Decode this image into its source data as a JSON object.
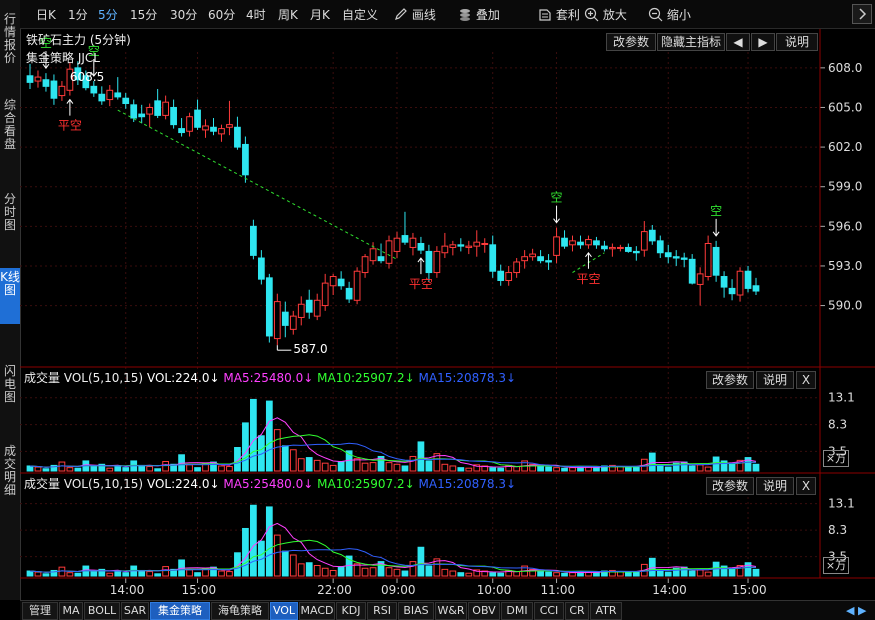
{
  "sidebar": [
    {
      "label": "行情报价",
      "active": false
    },
    {
      "label": "综合看盘",
      "active": false
    },
    {
      "label": "分时图",
      "active": false
    },
    {
      "label": "K线图",
      "active": true
    },
    {
      "label": "闪电图",
      "active": false
    },
    {
      "label": "成交明细",
      "active": false
    }
  ],
  "toolbar": {
    "periods": [
      "日K",
      "1分",
      "5分",
      "15分",
      "30分",
      "60分",
      "4时",
      "周K",
      "月K",
      "自定义"
    ],
    "active_period": "5分",
    "tools": [
      {
        "label": "画线",
        "icon": "pencil-icon"
      },
      {
        "label": "叠加",
        "icon": "stack-icon"
      },
      {
        "label": "套利",
        "icon": "arbitrage-icon"
      },
      {
        "label": "放大",
        "icon": "zoom-in-icon"
      },
      {
        "label": "缩小",
        "icon": "zoom-out-icon"
      }
    ],
    "collapse_icon": "chevron-right-icon"
  },
  "main_panel": {
    "title": "铁矿石主力 (5分钟)",
    "buttons": [
      "改参数",
      "隐藏主指标",
      "◀",
      "▶",
      "说明"
    ],
    "strategy_label": "集金策略 JJCL"
  },
  "chart_data": [
    {
      "type": "candlestick",
      "title": "铁矿石主力 (5分钟)",
      "yticks": [
        608.0,
        605.0,
        602.0,
        599.0,
        596.0,
        593.0,
        590.0
      ],
      "ylim": [
        585.5,
        609.2
      ],
      "xticks": [
        "14:00",
        "15:00",
        "22:00",
        "09:00",
        "10:00",
        "11:00",
        "14:00",
        "15:00"
      ],
      "up_color": "#ff3b3b",
      "down_color": "#2ee6f0",
      "high_label": "608.5",
      "low_label": "587.0",
      "candles": [
        {
          "o": 607.4,
          "h": 608.3,
          "l": 606.4,
          "c": 606.9
        },
        {
          "o": 607.0,
          "h": 607.8,
          "l": 606.5,
          "c": 607.3
        },
        {
          "o": 607.1,
          "h": 607.6,
          "l": 606.2,
          "c": 606.6
        },
        {
          "o": 607.0,
          "h": 607.5,
          "l": 605.2,
          "c": 605.7
        },
        {
          "o": 605.9,
          "h": 607.0,
          "l": 605.5,
          "c": 606.6
        },
        {
          "o": 606.3,
          "h": 608.4,
          "l": 605.9,
          "c": 607.9
        },
        {
          "o": 608.0,
          "h": 608.5,
          "l": 606.7,
          "c": 607.1
        },
        {
          "o": 607.4,
          "h": 607.8,
          "l": 606.3,
          "c": 606.5
        },
        {
          "o": 606.6,
          "h": 607.0,
          "l": 605.8,
          "c": 606.1
        },
        {
          "o": 606.0,
          "h": 606.6,
          "l": 605.2,
          "c": 605.5
        },
        {
          "o": 605.6,
          "h": 606.7,
          "l": 605.1,
          "c": 606.3
        },
        {
          "o": 606.1,
          "h": 607.3,
          "l": 605.6,
          "c": 605.8
        },
        {
          "o": 605.7,
          "h": 606.1,
          "l": 604.9,
          "c": 605.3
        },
        {
          "o": 605.2,
          "h": 605.6,
          "l": 603.9,
          "c": 604.2
        },
        {
          "o": 604.5,
          "h": 605.2,
          "l": 603.8,
          "c": 604.3
        },
        {
          "o": 604.5,
          "h": 605.3,
          "l": 603.5,
          "c": 605.0
        },
        {
          "o": 605.5,
          "h": 606.4,
          "l": 604.2,
          "c": 604.4
        },
        {
          "o": 604.4,
          "h": 605.9,
          "l": 604.1,
          "c": 605.4
        },
        {
          "o": 605.0,
          "h": 605.6,
          "l": 603.4,
          "c": 603.7
        },
        {
          "o": 603.4,
          "h": 604.2,
          "l": 602.8,
          "c": 603.1
        },
        {
          "o": 603.2,
          "h": 604.6,
          "l": 602.8,
          "c": 604.3
        },
        {
          "o": 604.8,
          "h": 605.6,
          "l": 603.3,
          "c": 603.5
        },
        {
          "o": 603.3,
          "h": 604.1,
          "l": 602.7,
          "c": 603.6
        },
        {
          "o": 603.5,
          "h": 604.2,
          "l": 602.9,
          "c": 603.2
        },
        {
          "o": 603.0,
          "h": 603.7,
          "l": 602.4,
          "c": 603.4
        },
        {
          "o": 603.5,
          "h": 605.5,
          "l": 602.9,
          "c": 603.7
        },
        {
          "o": 603.5,
          "h": 604.3,
          "l": 601.8,
          "c": 602.0
        },
        {
          "o": 602.2,
          "h": 602.8,
          "l": 599.3,
          "c": 599.9
        },
        {
          "o": 596.0,
          "h": 596.5,
          "l": 593.5,
          "c": 593.8
        },
        {
          "o": 593.6,
          "h": 594.2,
          "l": 591.6,
          "c": 592.0
        },
        {
          "o": 592.1,
          "h": 592.4,
          "l": 587.2,
          "c": 587.7
        },
        {
          "o": 587.5,
          "h": 590.9,
          "l": 587.0,
          "c": 590.3
        },
        {
          "o": 589.5,
          "h": 590.3,
          "l": 587.6,
          "c": 588.5
        },
        {
          "o": 588.2,
          "h": 589.6,
          "l": 587.8,
          "c": 589.2
        },
        {
          "o": 589.1,
          "h": 590.7,
          "l": 588.5,
          "c": 590.1
        },
        {
          "o": 590.4,
          "h": 591.2,
          "l": 589.0,
          "c": 589.5
        },
        {
          "o": 589.2,
          "h": 590.9,
          "l": 588.9,
          "c": 590.4
        },
        {
          "o": 590.0,
          "h": 592.4,
          "l": 589.6,
          "c": 591.7
        },
        {
          "o": 591.5,
          "h": 592.4,
          "l": 590.8,
          "c": 592.2
        },
        {
          "o": 592.0,
          "h": 592.6,
          "l": 591.2,
          "c": 591.5
        },
        {
          "o": 591.3,
          "h": 591.8,
          "l": 590.2,
          "c": 590.5
        },
        {
          "o": 590.4,
          "h": 592.9,
          "l": 590.1,
          "c": 592.6
        },
        {
          "o": 592.5,
          "h": 593.9,
          "l": 592.1,
          "c": 593.7
        },
        {
          "o": 593.4,
          "h": 594.8,
          "l": 593.1,
          "c": 594.3
        },
        {
          "o": 593.7,
          "h": 594.7,
          "l": 593.2,
          "c": 593.4
        },
        {
          "o": 593.2,
          "h": 595.3,
          "l": 592.8,
          "c": 594.9
        },
        {
          "o": 594.1,
          "h": 595.6,
          "l": 593.6,
          "c": 595.1
        },
        {
          "o": 595.3,
          "h": 597.1,
          "l": 594.6,
          "c": 594.8
        },
        {
          "o": 594.4,
          "h": 595.5,
          "l": 593.8,
          "c": 595.1
        },
        {
          "o": 594.7,
          "h": 595.2,
          "l": 593.9,
          "c": 594.2
        },
        {
          "o": 594.1,
          "h": 594.6,
          "l": 591.8,
          "c": 592.5
        },
        {
          "o": 592.5,
          "h": 594.5,
          "l": 592.1,
          "c": 594.1
        },
        {
          "o": 594.0,
          "h": 595.5,
          "l": 593.6,
          "c": 594.5
        },
        {
          "o": 594.4,
          "h": 594.9,
          "l": 593.8,
          "c": 594.6
        },
        {
          "o": 594.6,
          "h": 595.1,
          "l": 594.1,
          "c": 594.5
        },
        {
          "o": 594.4,
          "h": 594.9,
          "l": 593.9,
          "c": 594.5
        },
        {
          "o": 594.5,
          "h": 595.7,
          "l": 593.7,
          "c": 594.8
        },
        {
          "o": 594.7,
          "h": 595.1,
          "l": 594.0,
          "c": 594.7
        },
        {
          "o": 594.6,
          "h": 595.3,
          "l": 592.1,
          "c": 592.6
        },
        {
          "o": 592.6,
          "h": 593.1,
          "l": 591.5,
          "c": 591.9
        },
        {
          "o": 591.9,
          "h": 593.0,
          "l": 591.5,
          "c": 592.5
        },
        {
          "o": 592.5,
          "h": 593.6,
          "l": 592.1,
          "c": 593.3
        },
        {
          "o": 593.4,
          "h": 594.2,
          "l": 592.8,
          "c": 593.7
        },
        {
          "o": 593.7,
          "h": 594.3,
          "l": 593.4,
          "c": 593.9
        },
        {
          "o": 593.7,
          "h": 594.2,
          "l": 593.2,
          "c": 593.4
        },
        {
          "o": 593.4,
          "h": 593.9,
          "l": 592.7,
          "c": 593.3
        },
        {
          "o": 593.8,
          "h": 595.9,
          "l": 593.2,
          "c": 595.2
        },
        {
          "o": 595.1,
          "h": 595.7,
          "l": 594.3,
          "c": 594.5
        },
        {
          "o": 594.6,
          "h": 595.3,
          "l": 594.1,
          "c": 594.9
        },
        {
          "o": 594.8,
          "h": 595.3,
          "l": 594.3,
          "c": 594.6
        },
        {
          "o": 594.6,
          "h": 595.3,
          "l": 594.3,
          "c": 595.0
        },
        {
          "o": 594.9,
          "h": 595.2,
          "l": 594.3,
          "c": 594.6
        },
        {
          "o": 594.5,
          "h": 594.9,
          "l": 594.1,
          "c": 594.3
        },
        {
          "o": 594.3,
          "h": 594.7,
          "l": 593.7,
          "c": 594.4
        },
        {
          "o": 594.4,
          "h": 594.6,
          "l": 594.1,
          "c": 594.4
        },
        {
          "o": 594.4,
          "h": 594.7,
          "l": 594.0,
          "c": 594.1
        },
        {
          "o": 594.1,
          "h": 594.5,
          "l": 593.4,
          "c": 594.0
        },
        {
          "o": 594.2,
          "h": 596.4,
          "l": 593.7,
          "c": 595.6
        },
        {
          "o": 595.7,
          "h": 596.1,
          "l": 594.6,
          "c": 594.9
        },
        {
          "o": 594.9,
          "h": 595.3,
          "l": 593.6,
          "c": 594.0
        },
        {
          "o": 594.0,
          "h": 594.6,
          "l": 593.2,
          "c": 593.7
        },
        {
          "o": 593.7,
          "h": 594.2,
          "l": 593.0,
          "c": 593.6
        },
        {
          "o": 593.6,
          "h": 594.0,
          "l": 592.9,
          "c": 593.5
        },
        {
          "o": 593.5,
          "h": 593.9,
          "l": 591.6,
          "c": 591.7
        },
        {
          "o": 591.6,
          "h": 592.9,
          "l": 590.0,
          "c": 592.4
        },
        {
          "o": 592.2,
          "h": 595.3,
          "l": 591.9,
          "c": 594.7
        },
        {
          "o": 594.4,
          "h": 594.9,
          "l": 591.8,
          "c": 592.3
        },
        {
          "o": 592.2,
          "h": 592.6,
          "l": 590.6,
          "c": 591.4
        },
        {
          "o": 591.3,
          "h": 592.0,
          "l": 590.4,
          "c": 590.9
        },
        {
          "o": 590.8,
          "h": 592.9,
          "l": 590.3,
          "c": 592.6
        },
        {
          "o": 592.6,
          "h": 593.0,
          "l": 591.0,
          "c": 591.3
        },
        {
          "o": 591.5,
          "h": 592.1,
          "l": 590.8,
          "c": 591.1
        }
      ],
      "signals": [
        {
          "i": 2,
          "type": "kong",
          "label": "空"
        },
        {
          "i": 5,
          "type": "pingkong",
          "label": "平空"
        },
        {
          "i": 8,
          "type": "kong",
          "label": "空"
        },
        {
          "i": 49,
          "type": "pingkong",
          "label": "平空"
        },
        {
          "i": 66,
          "type": "kong",
          "label": "空"
        },
        {
          "i": 70,
          "type": "pingkong",
          "label": "平空"
        },
        {
          "i": 86,
          "type": "kong",
          "label": "空"
        }
      ],
      "trend_line": [
        {
          "i": 11,
          "v": 604.8
        },
        {
          "i": 46,
          "v": 593.5
        }
      ],
      "trend_line2": [
        {
          "i": 68,
          "v": 592.5
        },
        {
          "i": 72,
          "v": 594.0
        }
      ]
    },
    {
      "type": "bar",
      "title": "成交量 VOL(5,10,15)",
      "yticks": [
        13.1,
        8.3,
        3.5
      ],
      "ylim": [
        0,
        15.2
      ],
      "unit": "×万",
      "values": [
        0.9,
        0.7,
        0.4,
        1.0,
        1.6,
        0.6,
        0.5,
        1.8,
        0.8,
        1.2,
        0.5,
        0.9,
        0.6,
        1.8,
        1.0,
        0.8,
        0.4,
        1.7,
        1.2,
        2.9,
        1.1,
        0.6,
        1.4,
        1.6,
        0.9,
        0.8,
        4.2,
        8.6,
        12.8,
        6.3,
        12.5,
        7.4,
        4.5,
        3.8,
        2.2,
        2.4,
        1.9,
        1.4,
        1.0,
        1.7,
        3.6,
        2.2,
        1.4,
        1.5,
        2.6,
        1.5,
        1.2,
        0.9,
        2.6,
        5.2,
        1.8,
        3.1,
        1.2,
        0.9,
        0.6,
        0.5,
        1.1,
        0.9,
        0.6,
        0.5,
        1.0,
        0.8,
        1.8,
        1.2,
        0.8,
        0.7,
        0.6,
        0.5,
        0.6,
        0.8,
        0.7,
        0.7,
        0.9,
        1.0,
        0.8,
        0.6,
        0.8,
        2.1,
        3.2,
        0.9,
        0.7,
        1.4,
        1.6,
        0.9,
        1.1,
        0.7,
        2.5,
        1.8,
        1.3,
        1.9,
        2.4,
        1.2
      ],
      "legend": [
        {
          "label": "VOL:224.0↓",
          "color": "#ffffff"
        },
        {
          "label": "MA5:25480.0↓",
          "color": "#ff40ff"
        },
        {
          "label": "MA10:25907.2↓",
          "color": "#30ff30"
        },
        {
          "label": "MA15:20878.3↓",
          "color": "#3060ff"
        }
      ]
    }
  ],
  "sub_panel": {
    "buttons": [
      "改参数",
      "说明",
      "X"
    ]
  },
  "bottom_tabs": [
    "管理",
    "MA",
    "BOLL",
    "SAR",
    "集金策略",
    "海龟策略",
    "VOL",
    "MACD",
    "KDJ",
    "RSI",
    "BIAS",
    "W&R",
    "OBV",
    "DMI",
    "CCI",
    "CR",
    "ATR"
  ],
  "active_tabs": [
    "集金策略",
    "VOL"
  ]
}
